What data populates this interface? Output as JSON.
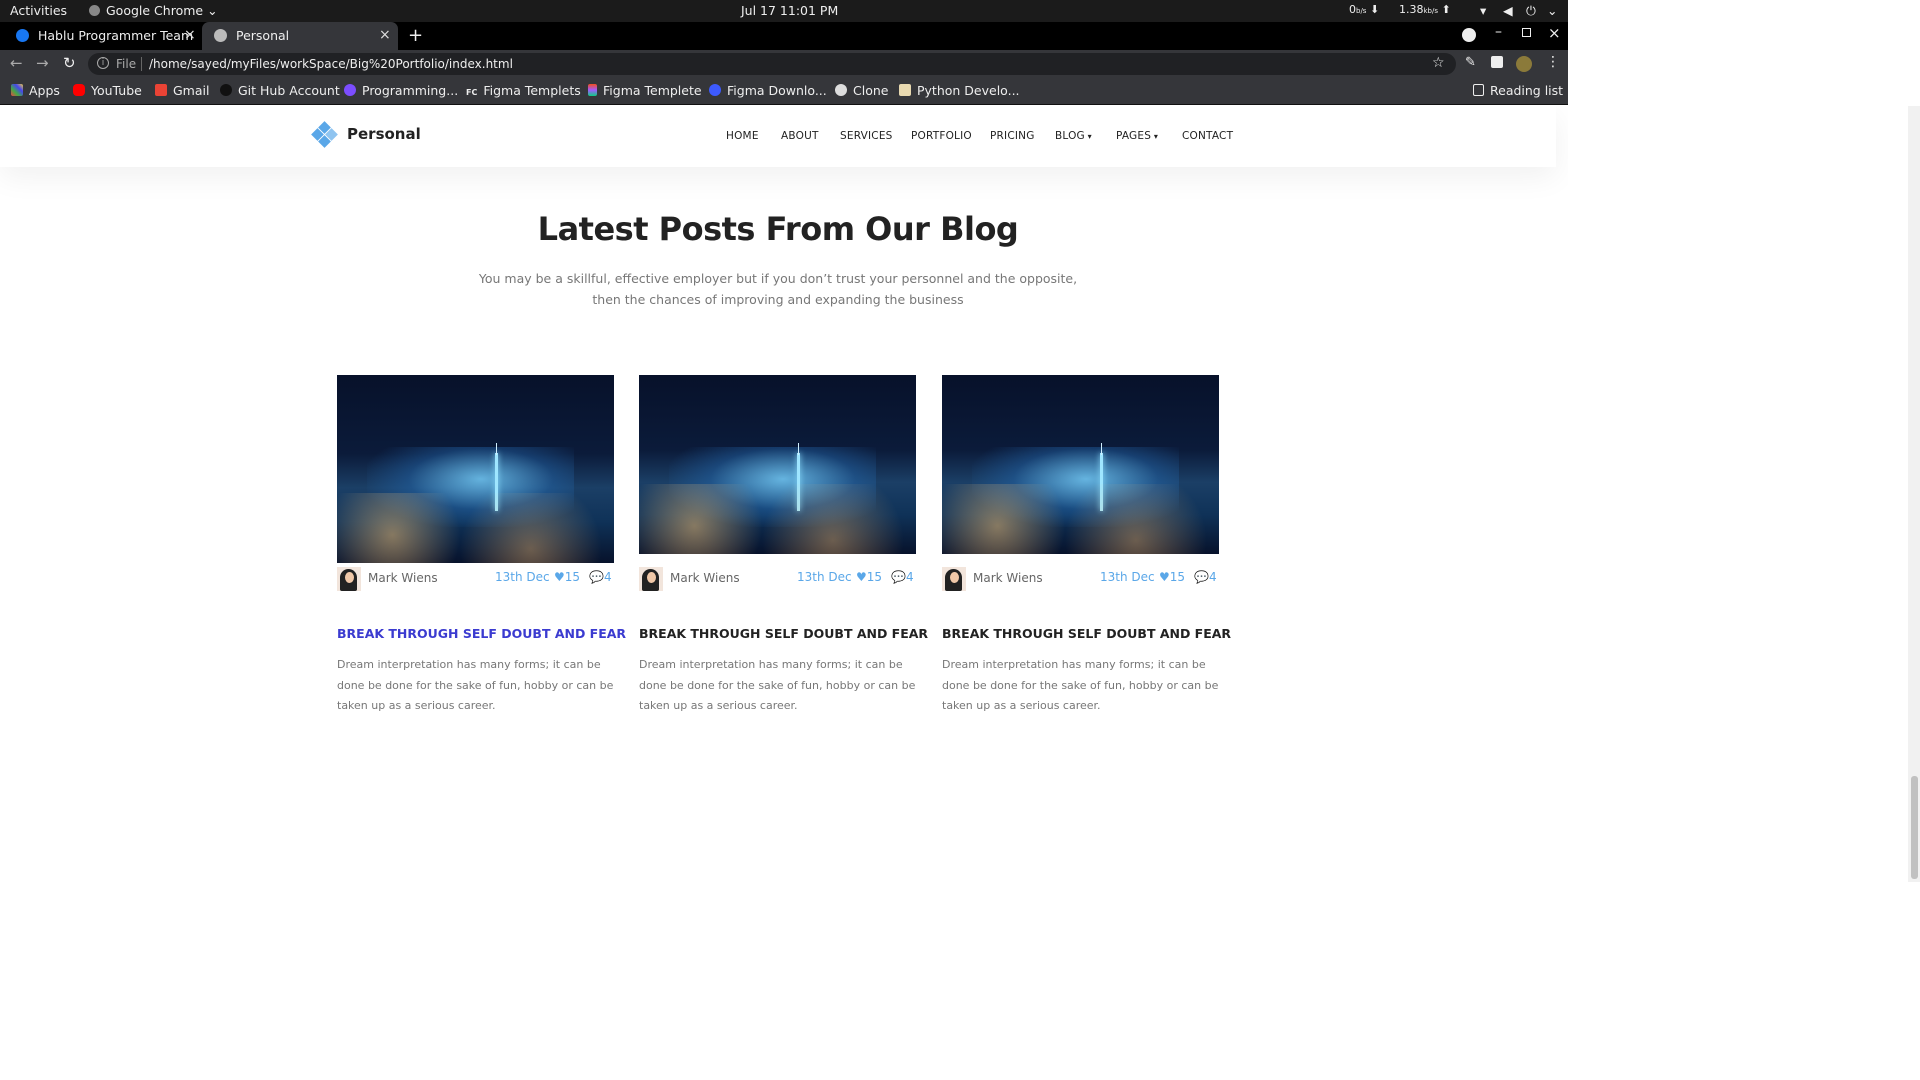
{
  "os_bar": {
    "activities": "Activities",
    "app": "Google Chrome",
    "clock": "Jul 17  11:01 PM",
    "net_down_value": "0",
    "net_down_unit": "b/s",
    "net_up_value": "1.38",
    "net_up_unit": "kb/s"
  },
  "tabs": [
    {
      "title": "Hablu Programmer Team"
    },
    {
      "title": "Personal"
    }
  ],
  "address": {
    "scheme_label": "File",
    "url": "/home/sayed/myFiles/workSpace/Big%20Portfolio/index.html"
  },
  "bookmarks": [
    "Apps",
    "YouTube",
    "Gmail",
    "Git Hub Account",
    "Programming...",
    "Figma Templets",
    "Figma Templete",
    "Figma Downlo...",
    "Clone",
    "Python Develo..."
  ],
  "bookmark_icon_labels": {
    "figma_templets": "FC"
  },
  "reading_list": "Reading list",
  "site": {
    "brand": "Personal",
    "menu": [
      "HOME",
      "ABOUT",
      "SERVICES",
      "PORTFOLIO",
      "PRICING",
      "BLOG",
      "PAGES",
      "CONTACT"
    ],
    "section_title": "Latest Posts From Our Blog",
    "section_intro": "You may be a skillful, effective employer but if you don’t trust your personnel and the opposite, then the chances of improving and expanding the business",
    "posts": [
      {
        "author": "Mark Wiens",
        "date": "13th Dec",
        "likes": "15",
        "comments": "4",
        "title": "BREAK THROUGH SELF DOUBT AND FEAR",
        "excerpt": "Dream interpretation has many forms; it can be done be done for the sake of fun, hobby or can be taken up as a serious career."
      },
      {
        "author": "Mark Wiens",
        "date": "13th Dec",
        "likes": "15",
        "comments": "4",
        "title": "BREAK THROUGH SELF DOUBT AND FEAR",
        "excerpt": "Dream interpretation has many forms; it can be done be done for the sake of fun, hobby or can be taken up as a serious career."
      },
      {
        "author": "Mark Wiens",
        "date": "13th Dec",
        "likes": "15",
        "comments": "4",
        "title": "BREAK THROUGH SELF DOUBT AND FEAR",
        "excerpt": "Dream interpretation has many forms; it can be done be done for the sake of fun, hobby or can be taken up as a serious career."
      }
    ]
  },
  "colors": {
    "accent": "#5aa7e8",
    "hover_title": "#3b3bd0",
    "heading": "#222222"
  }
}
